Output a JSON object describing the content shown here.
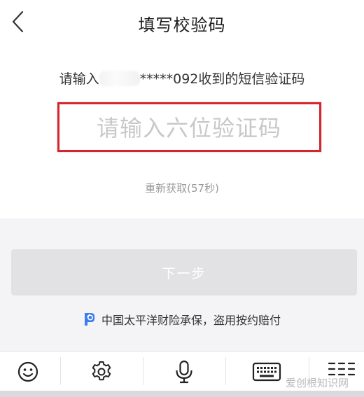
{
  "nav": {
    "title": "填写校验码"
  },
  "hint": {
    "prefix": "请输入",
    "suffix": "*****092收到的短信验证码"
  },
  "code_input": {
    "placeholder": "请输入六位验证码",
    "value": ""
  },
  "resend": {
    "label": "重新获取(57秒)"
  },
  "next_button": {
    "label": "下一步"
  },
  "guarantee": {
    "text": "中国太平洋财险承保，盗用按约赔付"
  },
  "keyboard_toolbar": {
    "icons": [
      "emoji-icon",
      "gear-icon",
      "microphone-icon",
      "keyboard-icon",
      "layout-icon"
    ]
  },
  "watermark": {
    "text": "爱创根知识网"
  },
  "colors": {
    "highlight_border": "#d6252c",
    "shield_blue": "#3a7df0",
    "disabled_button": "#e2e2e4"
  }
}
